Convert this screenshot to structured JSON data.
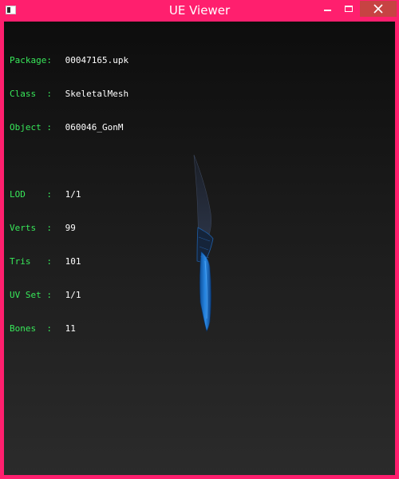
{
  "window": {
    "title": "UE Viewer",
    "accent": "#ff1f6e",
    "close_hover": "#c74343"
  },
  "icons": {
    "app": "app-icon",
    "minimize": "minimize-icon",
    "maximize": "maximize-icon",
    "close": "close-icon"
  },
  "info": {
    "package": {
      "label": "Package:",
      "value": "00047165.upk"
    },
    "class": {
      "label": "Class  :",
      "value": "SkeletalMesh"
    },
    "object": {
      "label": "Object :",
      "value": "060046_GonM"
    },
    "lod": {
      "label": "LOD    :",
      "value": "1/1"
    },
    "verts": {
      "label": "Verts  :",
      "value": "99"
    },
    "tris": {
      "label": "Tris   :",
      "value": "101"
    },
    "uvset": {
      "label": "UV Set :",
      "value": "1/1"
    },
    "bones": {
      "label": "Bones  :",
      "value": "11"
    }
  },
  "colors": {
    "label": "#38e85a",
    "value": "#ffffff",
    "mesh_blue": "#1f7fd6",
    "mesh_dark": "#2a3040"
  }
}
